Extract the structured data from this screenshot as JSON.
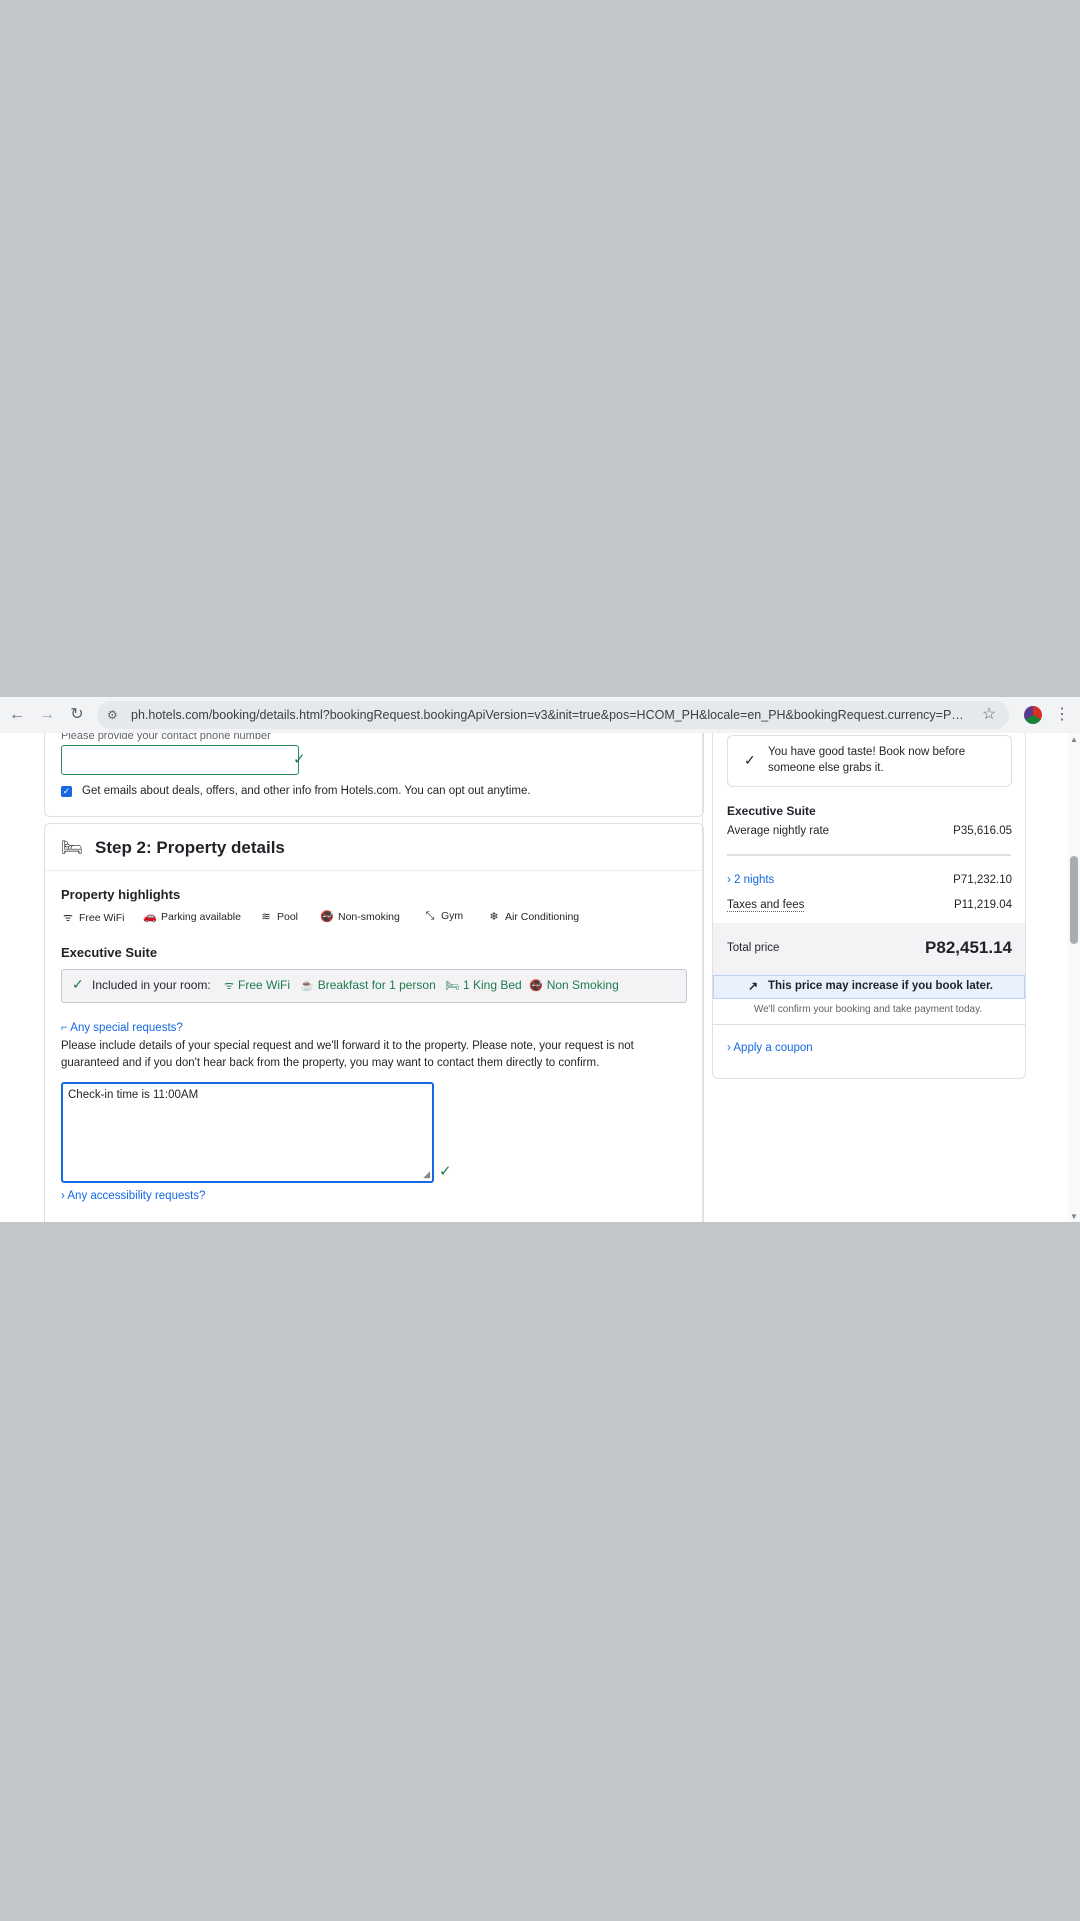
{
  "browser": {
    "url": "ph.hotels.com/booking/details.html?bookingRequest.bookingApiVersion=v3&init=true&pos=HCOM_PH&locale=en_PH&bookingRequest.currency=PHP&booki..."
  },
  "contact": {
    "phone_label": "Please provide your contact phone number",
    "phone_value": "",
    "email_optin_label": "Get emails about deals, offers, and other info from Hotels.com. You can opt out anytime."
  },
  "step2": {
    "title": "Step 2: Property details",
    "highlights_heading": "Property highlights",
    "highlights": [
      {
        "label": "Free WiFi",
        "icon": "wifi-icon"
      },
      {
        "label": "Parking available",
        "icon": "car-icon"
      },
      {
        "label": "Pool",
        "icon": "pool-icon"
      },
      {
        "label": "Non-smoking",
        "icon": "no-smoking-icon"
      },
      {
        "label": "Gym",
        "icon": "gym-icon"
      },
      {
        "label": "Air Conditioning",
        "icon": "snowflake-icon"
      }
    ],
    "room_name": "Executive Suite",
    "included_label": "Included in your room:",
    "included": [
      {
        "label": "Free WiFi",
        "icon": "wifi-icon"
      },
      {
        "label": "Breakfast for 1 person",
        "icon": "coffee-icon"
      },
      {
        "label": "1 King Bed",
        "icon": "bed-icon"
      },
      {
        "label": "Non Smoking",
        "icon": "no-smoking-icon"
      }
    ],
    "special_requests_link": "Any special requests?",
    "special_requests_info": "Please include details of your special request and we'll forward it to the property. Please note, your request is not guaranteed and if you don't hear back from the property, you may want to contact them directly to confirm.",
    "special_requests_value": "Check-in time is 11:00AM",
    "accessibility_link": "Any accessibility requests?"
  },
  "summary": {
    "good_taste_msg": "You have good taste! Book now before someone else grabs it.",
    "room_name": "Executive Suite",
    "avg_rate_label": "Average nightly rate",
    "avg_rate_value": "P35,616.05",
    "nights_label": "2 nights",
    "nights_value": "P71,232.10",
    "taxes_label": "Taxes and fees",
    "taxes_value": "P11,219.04",
    "total_label": "Total price",
    "total_value": "P82,451.14",
    "price_warning": "This price may increase if you book later.",
    "confirm_note": "We'll confirm your booking and take payment today.",
    "coupon_link": "Apply a coupon"
  },
  "colors": {
    "link": "#1668e3",
    "success": "#1d7c4d",
    "warning_bg": "#e9f2fc",
    "page_bg": "#c2c5c9",
    "total_bg": "#f3f3f5"
  }
}
